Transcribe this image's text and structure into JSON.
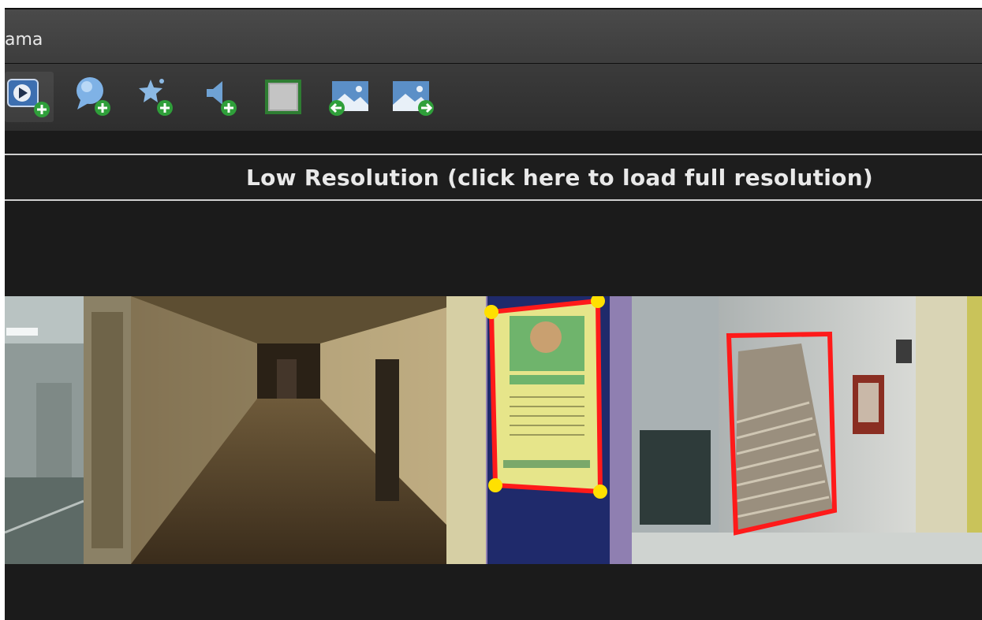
{
  "window": {
    "title": "ama"
  },
  "toolbar": {
    "tools": [
      {
        "name": "add-video-icon"
      },
      {
        "name": "add-info-bubble-icon"
      },
      {
        "name": "add-star-hotspot-icon"
      },
      {
        "name": "add-sound-icon"
      },
      {
        "name": "add-frame-icon"
      },
      {
        "name": "image-previous-icon"
      },
      {
        "name": "image-next-icon"
      }
    ]
  },
  "notice": {
    "low_resolution_text": "Low Resolution (click here to load full resolution)"
  },
  "colors": {
    "background": "#1b1b1b",
    "polygon_outline": "#ff1a1a",
    "handle": "#ffe000",
    "poster_frame": "#1f2a6b"
  }
}
